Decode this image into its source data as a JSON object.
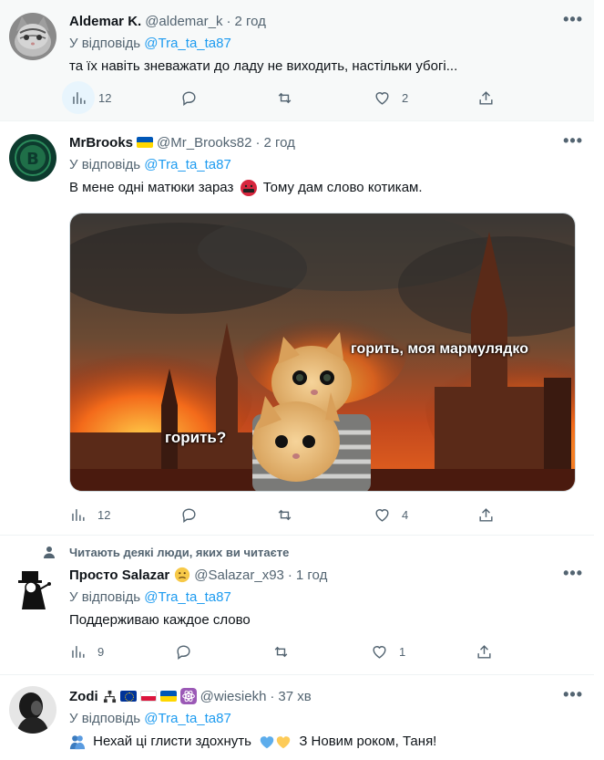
{
  "tweets": [
    {
      "name": "Aldemar K.",
      "handle": "@aldemar_k",
      "time": "2 год",
      "reply_prefix": "У відповідь",
      "reply_to": "@Tra_ta_ta87",
      "text": "та їх навіть зневажати до ладу не виходить, настільки убогі...",
      "stats": {
        "views": "12",
        "replies": "",
        "retweets": "",
        "likes": "2"
      }
    },
    {
      "name": "MrBrooks",
      "handle": "@Mr_Brooks82",
      "time": "2 год",
      "reply_prefix": "У відповідь",
      "reply_to": "@Tra_ta_ta87",
      "text_before": "В мене одні матюки зараз",
      "text_after": "Тому дам слово котикам.",
      "meme": {
        "caption_left": "горить?",
        "caption_right": "горить, моя мармулядко"
      },
      "stats": {
        "views": "12",
        "replies": "",
        "retweets": "",
        "likes": "4"
      }
    },
    {
      "social_context": "Читають деякі люди, яких ви читаєте",
      "name": "Просто Salazar",
      "handle": "@Salazar_x93",
      "time": "1 год",
      "reply_prefix": "У відповідь",
      "reply_to": "@Tra_ta_ta87",
      "text": "Поддерживаю каждое слово",
      "stats": {
        "views": "9",
        "replies": "",
        "retweets": "",
        "likes": "1"
      }
    },
    {
      "name": "Zodi",
      "handle": "@wiesiekh",
      "time": "37 хв",
      "reply_prefix": "У відповідь",
      "reply_to": "@Tra_ta_ta87",
      "text_before": "Нехай ці глисти здохнуть",
      "text_after": "З Новим роком, Таня!"
    }
  ],
  "icons": [
    "views-icon",
    "reply-icon",
    "retweet-icon",
    "like-icon",
    "share-icon",
    "more-icon",
    "person-icon"
  ],
  "colors": {
    "link": "#1d9bf0",
    "secondary": "#536471",
    "hover_bg": "#e8f5fd"
  }
}
